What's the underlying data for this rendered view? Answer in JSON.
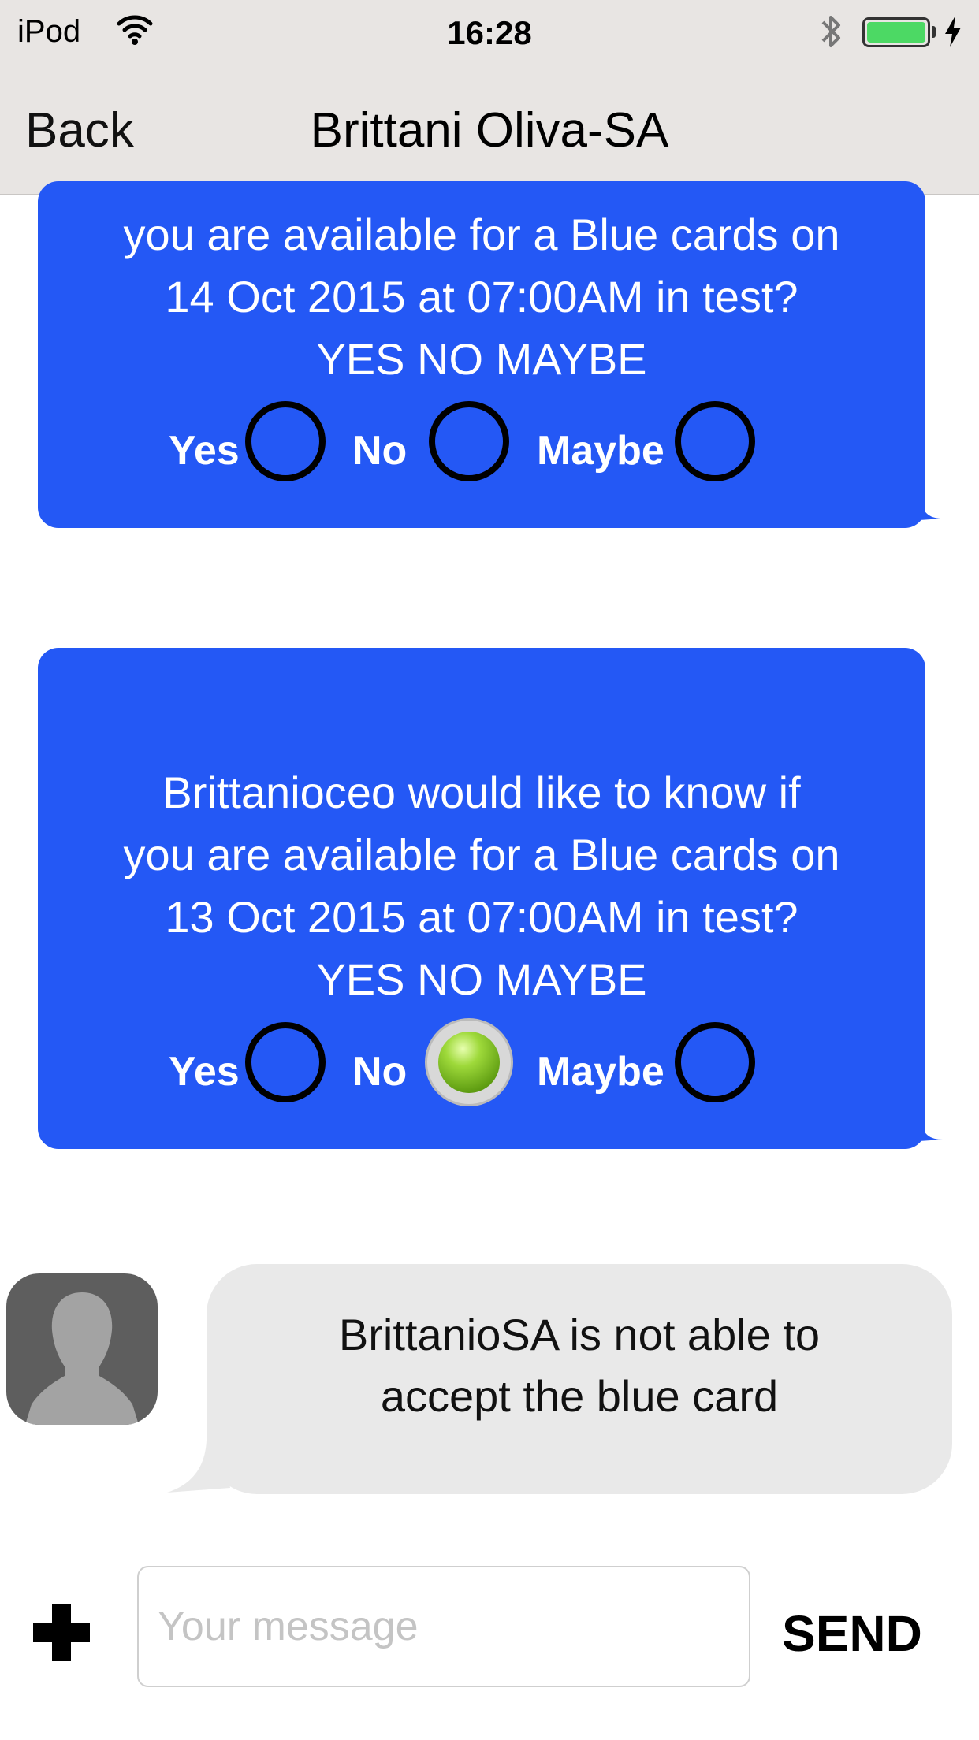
{
  "status_bar": {
    "carrier": "iPod",
    "time": "16:28",
    "battery_level": 1.0
  },
  "nav": {
    "back_label": "Back",
    "title": "Brittani Oliva-SA"
  },
  "messages": [
    {
      "text": "you are available for a Blue cards on\n14 Oct 2015 at 07:00AM in test?\nYES NO MAYBE",
      "options": {
        "yes": "Yes",
        "no": "No",
        "maybe": "Maybe"
      },
      "selected": null
    },
    {
      "text": "Brittanioceo would like to know if\nyou are available for a Blue cards on\n13 Oct 2015 at 07:00AM in test?\nYES NO MAYBE",
      "options": {
        "yes": "Yes",
        "no": "No",
        "maybe": "Maybe"
      },
      "selected": "No"
    }
  ],
  "reply": {
    "text": "BrittanioSA is not able to\naccept the blue card"
  },
  "composer": {
    "placeholder": "Your message",
    "value": "",
    "send_label": "SEND"
  },
  "colors": {
    "bubble_blue": "#2458f5",
    "bubble_gray": "#e9e9e9",
    "nav_bg": "#e8e5e3",
    "battery": "#4cd964",
    "selected_radio": "#7cbf1f"
  }
}
